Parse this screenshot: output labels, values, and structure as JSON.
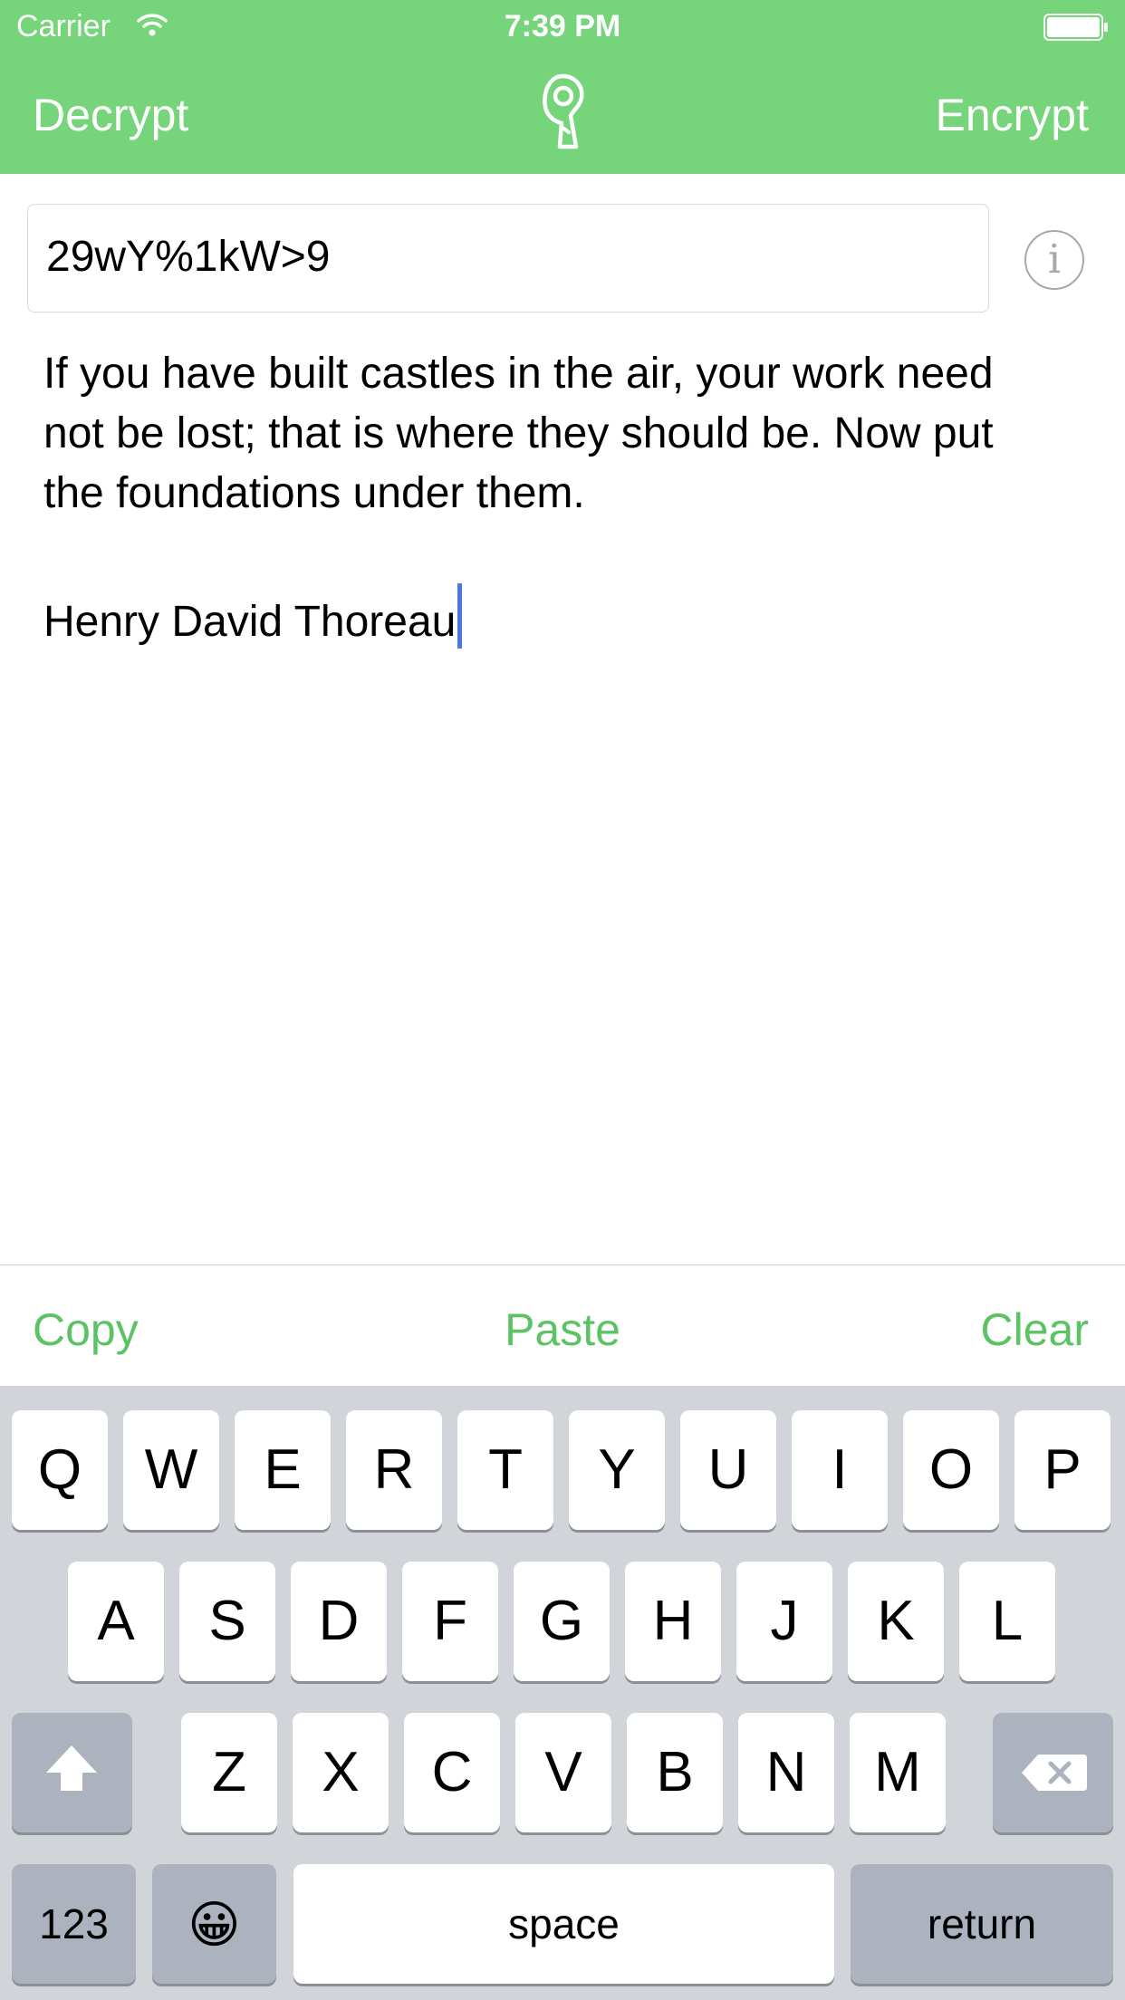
{
  "status_bar": {
    "carrier": "Carrier",
    "time": "7:39 PM"
  },
  "nav": {
    "left_label": "Decrypt",
    "right_label": "Encrypt",
    "logo_icon": "key-hole-logo-icon"
  },
  "password": {
    "value": "29wY%1kW>9"
  },
  "info_icon": "info-icon",
  "info_glyph": "i",
  "message": {
    "lines": [
      "If you have built castles in the air, your work need",
      "not be lost; that is where they should be. Now put",
      "the foundations under them."
    ],
    "author": "Henry David Thoreau"
  },
  "toolbar": {
    "copy_label": "Copy",
    "paste_label": "Paste",
    "clear_label": "Clear"
  },
  "keyboard": {
    "row1": [
      "Q",
      "W",
      "E",
      "R",
      "T",
      "Y",
      "U",
      "I",
      "O",
      "P"
    ],
    "row2": [
      "A",
      "S",
      "D",
      "F",
      "G",
      "H",
      "J",
      "K",
      "L"
    ],
    "row3": [
      "Z",
      "X",
      "C",
      "V",
      "B",
      "N",
      "M"
    ],
    "numbers_label": "123",
    "emoji_label": "😀",
    "space_label": "space",
    "return_label": "return",
    "shift_icon": "shift-icon",
    "delete_icon": "delete-icon"
  },
  "colors": {
    "accent": "#76d47a",
    "action_text": "#5cc365",
    "caret": "#4a74e8",
    "keyboard_bg": "#d1d4d9"
  }
}
